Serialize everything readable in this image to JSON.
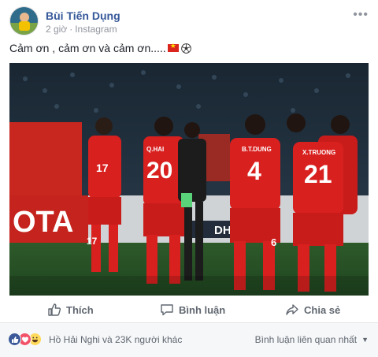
{
  "post": {
    "author": "Bùi Tiến Dụng",
    "time": "2 giờ",
    "source": "Instagram",
    "text": "Cảm ơn , cảm ơn và cảm ơn....."
  },
  "photo": {
    "players": [
      {
        "number": "17"
      },
      {
        "number": "20",
        "name": "Q.HAI"
      },
      {
        "number": "4",
        "name": "B.T.DUNG"
      },
      {
        "number": "21",
        "name": "X.TRUONG"
      },
      {
        "number": "6"
      },
      {
        "number": "17"
      }
    ],
    "board_text": "OTA",
    "sponsor_text": "DHB"
  },
  "actions": {
    "like": "Thích",
    "comment": "Bình luận",
    "share": "Chia sẻ"
  },
  "footer": {
    "reactions_text": "Hồ Hải Nghi và 23K người khác",
    "sort_label": "Bình luận liên quan nhất"
  },
  "colors": {
    "link": "#365899",
    "jersey": "#d8201f",
    "like": "#3b5998",
    "love": "#f25268",
    "haha": "#ffd95a"
  }
}
